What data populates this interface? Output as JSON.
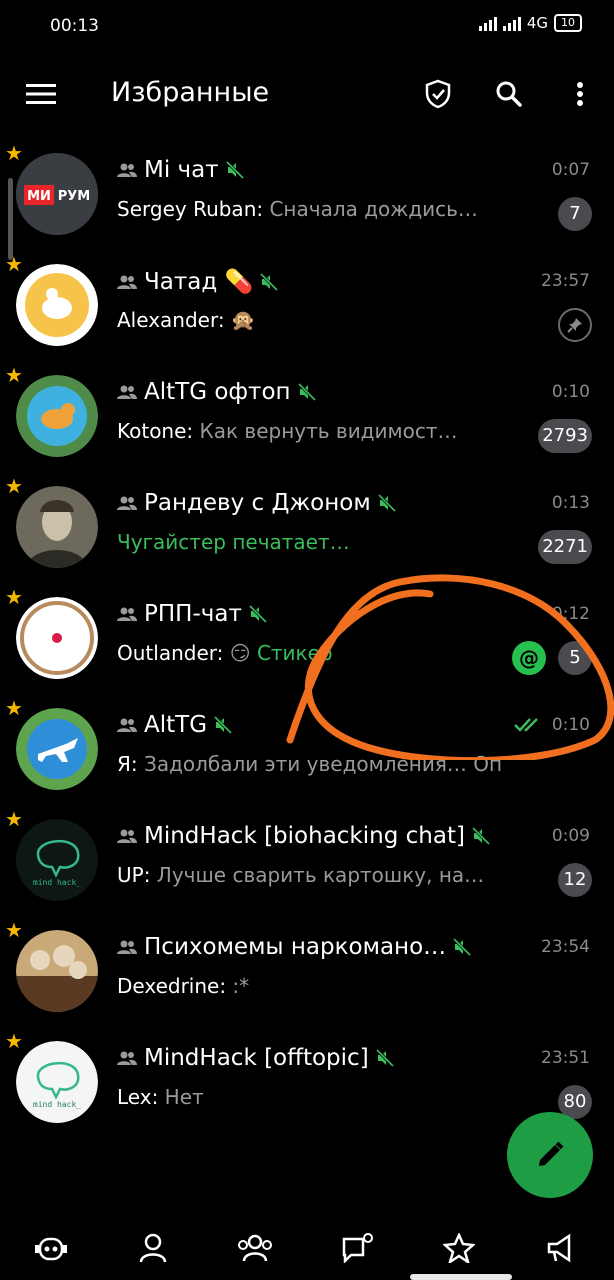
{
  "status_bar": {
    "time": "00:13",
    "network": "4G",
    "battery": "10"
  },
  "toolbar": {
    "title": "Избранные",
    "icons": [
      "menu-icon",
      "shield-check-icon",
      "search-icon",
      "more-vert-icon"
    ]
  },
  "chats": [
    {
      "title": "Mi чат",
      "time": "0:07",
      "sender": "Sergey Ruban:",
      "message": " Сначала дождись…",
      "badge": "7",
      "avatar_label": "МИ РУМ"
    },
    {
      "title": "Чатад 💊",
      "time": "23:57",
      "sender": "Alexander:",
      "message": " 🙊",
      "pinned": true
    },
    {
      "title": "AltTG офтоп",
      "time": "0:10",
      "sender": "Kotone:",
      "message": " Как вернуть видимост…",
      "badge": "2793"
    },
    {
      "title": "Рандеву с Джоном",
      "time": "0:13",
      "sender": "",
      "message": "Чугайстер печатает…",
      "typing": true,
      "badge": "2271"
    },
    {
      "title": "РПП-чат",
      "time": "0:12",
      "sender": "Outlander:",
      "message": " 😏 ",
      "message_green": "Стикер",
      "badge": "5",
      "mention": "@"
    },
    {
      "title": "AltTG",
      "time": "0:10",
      "sender": "Я:",
      "message": " Задолбали эти уведомления… Оп",
      "read": true
    },
    {
      "title": "MindHack [biohacking chat]",
      "time": "0:09",
      "sender": "UP:",
      "message": " Лучше сварить картошку, на…",
      "badge": "12"
    },
    {
      "title": "Психомемы наркомано…",
      "time": "23:54",
      "sender": "Dexedrine:",
      "message": " :*"
    },
    {
      "title": "MindHack [offtopic]",
      "time": "23:51",
      "sender": "Lex:",
      "message": " Нет",
      "badge": "80"
    }
  ],
  "colors": {
    "accent": "#3bbd5e",
    "badge": "#4b4b4f",
    "fab": "#1f9d45",
    "star": "#f5b800",
    "annotation": "#f0701f"
  },
  "bottom_nav": [
    "bot-icon",
    "contacts-icon",
    "groups-icon",
    "chat-icon",
    "favorites-star-icon",
    "channels-icon"
  ]
}
